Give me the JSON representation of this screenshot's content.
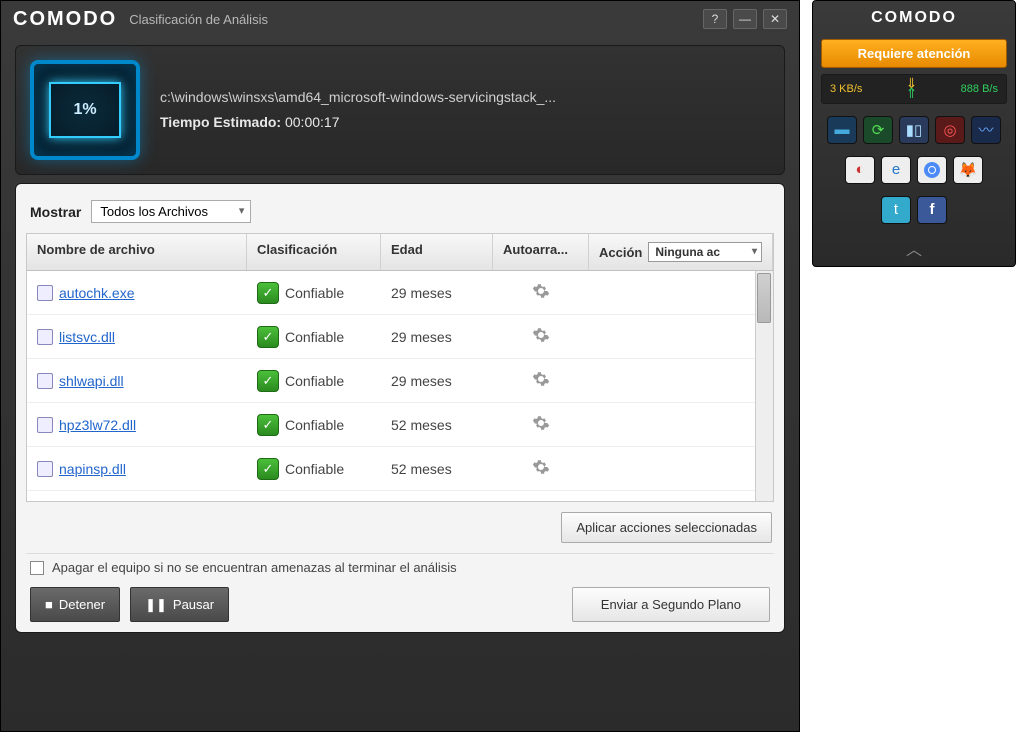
{
  "window": {
    "brand": "COMODO",
    "title": "Clasificación de Análisis"
  },
  "progress": {
    "percent": "1%",
    "path": "c:\\windows\\winsxs\\amd64_microsoft-windows-servicingstack_...",
    "eta_label": "Tiempo Estimado:",
    "eta_value": "00:00:17"
  },
  "filter": {
    "label": "Mostrar",
    "value": "Todos los Archivos"
  },
  "columns": {
    "name": "Nombre de archivo",
    "classification": "Clasificación",
    "age": "Edad",
    "autorun": "Autoarra...",
    "action": "Acción",
    "action_value": "Ninguna ac"
  },
  "rows": [
    {
      "file": "autochk.exe",
      "class": "Confiable",
      "age": "29 meses"
    },
    {
      "file": "listsvc.dll",
      "class": "Confiable",
      "age": "29 meses"
    },
    {
      "file": "shlwapi.dll",
      "class": "Confiable",
      "age": "29 meses"
    },
    {
      "file": "hpz3lw72.dll",
      "class": "Confiable",
      "age": "52 meses"
    },
    {
      "file": "napinsp.dll",
      "class": "Confiable",
      "age": "52 meses"
    }
  ],
  "buttons": {
    "apply": "Aplicar acciones seleccionadas",
    "shutdown": "Apagar el equipo si no se encuentran amenazas al terminar el análisis",
    "stop": "Detener",
    "pause": "Pausar",
    "background": "Enviar a Segundo Plano"
  },
  "widget": {
    "brand": "COMODO",
    "alert": "Requiere atención",
    "down": "3 KB/s",
    "up": "888 B/s"
  }
}
